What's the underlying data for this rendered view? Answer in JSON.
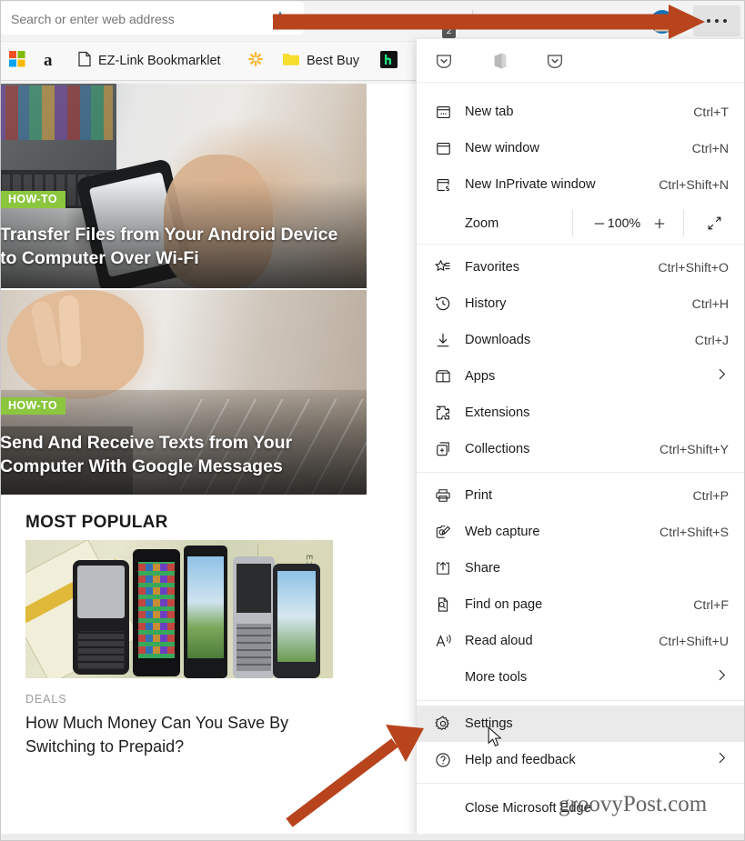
{
  "browser": {
    "name": "Microsoft Edge",
    "omnibox_value": "",
    "omnibox_placeholder": "Search or enter web address",
    "toolbar_icons": [
      {
        "name": "favorite-star-icon",
        "glyph": "star"
      },
      {
        "name": "dashlane-extension-icon",
        "glyph": "D."
      },
      {
        "name": "lastpass-extension-icon",
        "glyph": "shield"
      },
      {
        "name": "honey-extension-icon",
        "glyph": "honey",
        "badge": "2"
      },
      {
        "name": "collections-icon",
        "glyph": "collections"
      },
      {
        "name": "immersive-reader-icon",
        "glyph": "reader"
      },
      {
        "name": "add-collection-icon",
        "glyph": "add-collection"
      },
      {
        "name": "profile-avatar",
        "glyph": "avatar"
      }
    ],
    "settings_and_more_label": "Settings and more"
  },
  "bookmarks": {
    "items": [
      {
        "label": "",
        "icon": "microsoft-icon"
      },
      {
        "label": "",
        "icon": "amazon-icon"
      },
      {
        "label": "EZ-Link Bookmarklet",
        "icon": "page-icon"
      },
      {
        "label": "",
        "icon": "walmart-icon"
      },
      {
        "label": "Best Buy",
        "icon": "folder-icon"
      },
      {
        "label": "",
        "icon": "hulu-icon"
      }
    ]
  },
  "page": {
    "cards": [
      {
        "tag": "HOW-TO",
        "title": "Transfer Files from Your Android Device to Computer Over Wi-Fi",
        "image_alt": "hand holding smartphone in front of laptop"
      },
      {
        "tag": "HOW-TO",
        "title": "Send And Receive Texts from Your Computer With Google Messages",
        "image_alt": "hands typing on laptop keyboard"
      }
    ],
    "most_popular": {
      "heading": "MOST POPULAR",
      "item": {
        "kicker": "DEALS",
        "title": "How Much Money Can You Save By Switching to Prepaid?",
        "image_alt": "row of mobile phones on top of money"
      }
    }
  },
  "menu": {
    "extensions_row": [
      {
        "name": "pocket-extension-icon"
      },
      {
        "name": "office-extension-icon"
      },
      {
        "name": "pocket-extension-icon-2"
      }
    ],
    "groups": [
      {
        "items": [
          {
            "label": "New tab",
            "shortcut": "Ctrl+T",
            "icon": "new-tab-icon",
            "submenu": false
          },
          {
            "label": "New window",
            "shortcut": "Ctrl+N",
            "icon": "new-window-icon",
            "submenu": false
          },
          {
            "label": "New InPrivate window",
            "shortcut": "Ctrl+Shift+N",
            "icon": "inprivate-icon",
            "submenu": false
          }
        ]
      },
      {
        "items": [
          {
            "label": "Favorites",
            "shortcut": "Ctrl+Shift+O",
            "icon": "favorites-icon",
            "submenu": false
          },
          {
            "label": "History",
            "shortcut": "Ctrl+H",
            "icon": "history-icon",
            "submenu": false
          },
          {
            "label": "Downloads",
            "shortcut": "Ctrl+J",
            "icon": "downloads-icon",
            "submenu": false
          },
          {
            "label": "Apps",
            "shortcut": "",
            "icon": "apps-icon",
            "submenu": true
          },
          {
            "label": "Extensions",
            "shortcut": "",
            "icon": "extensions-icon",
            "submenu": false
          },
          {
            "label": "Collections",
            "shortcut": "Ctrl+Shift+Y",
            "icon": "collections-icon",
            "submenu": false
          }
        ]
      },
      {
        "items": [
          {
            "label": "Print",
            "shortcut": "Ctrl+P",
            "icon": "print-icon",
            "submenu": false
          },
          {
            "label": "Web capture",
            "shortcut": "Ctrl+Shift+S",
            "icon": "web-capture-icon",
            "submenu": false
          },
          {
            "label": "Share",
            "shortcut": "",
            "icon": "share-icon",
            "submenu": false
          },
          {
            "label": "Find on page",
            "shortcut": "Ctrl+F",
            "icon": "find-icon",
            "submenu": false
          },
          {
            "label": "Read aloud",
            "shortcut": "Ctrl+Shift+U",
            "icon": "read-aloud-icon",
            "submenu": false
          },
          {
            "label": "More tools",
            "shortcut": "",
            "icon": "",
            "submenu": true
          }
        ]
      },
      {
        "items": [
          {
            "label": "Settings",
            "shortcut": "",
            "icon": "settings-gear-icon",
            "submenu": false,
            "selected": true
          },
          {
            "label": "Help and feedback",
            "shortcut": "",
            "icon": "help-icon",
            "submenu": true
          }
        ]
      }
    ],
    "zoom": {
      "label": "Zoom",
      "value": "100%",
      "minus_label": "Zoom out",
      "plus_label": "Zoom in",
      "fullscreen_label": "Full screen"
    },
    "close_item": {
      "label": "Close Microsoft Edge"
    }
  },
  "annotations": {
    "arrow_color": "#b8441d",
    "arrow_top_target": "settings-and-more-button",
    "arrow_bottom_target": "menu-item-settings"
  },
  "watermark": {
    "text": "groovyPost.com"
  },
  "colors": {
    "accent_green": "#8cc63e",
    "menu_bg": "#ffffff",
    "chrome_bg": "#f3f3f3",
    "selected_row": "#eaeaea",
    "arrow": "#b8441d"
  }
}
